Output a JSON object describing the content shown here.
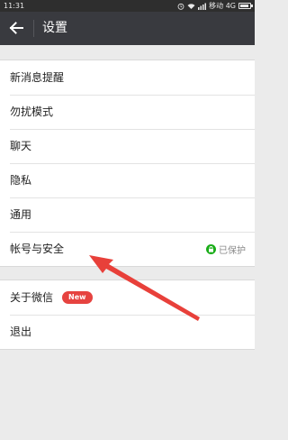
{
  "status_bar": {
    "time": "11:31",
    "carrier": "移动 4G"
  },
  "header": {
    "title": "设置",
    "back_icon": "arrow-left-icon"
  },
  "groups": [
    {
      "items": [
        {
          "label": "新消息提醒"
        },
        {
          "label": "勿扰模式"
        },
        {
          "label": "聊天"
        },
        {
          "label": "隐私"
        },
        {
          "label": "通用"
        },
        {
          "label": "帐号与安全",
          "status": "已保护",
          "status_icon": "lock-icon"
        }
      ]
    },
    {
      "items": [
        {
          "label": "关于微信",
          "badge": "New"
        },
        {
          "label": "退出"
        }
      ]
    }
  ],
  "colors": {
    "header_bg": "#393a3f",
    "badge_red": "#e64340",
    "protect_green": "#1aad19",
    "annotation_red": "#e8403a"
  }
}
